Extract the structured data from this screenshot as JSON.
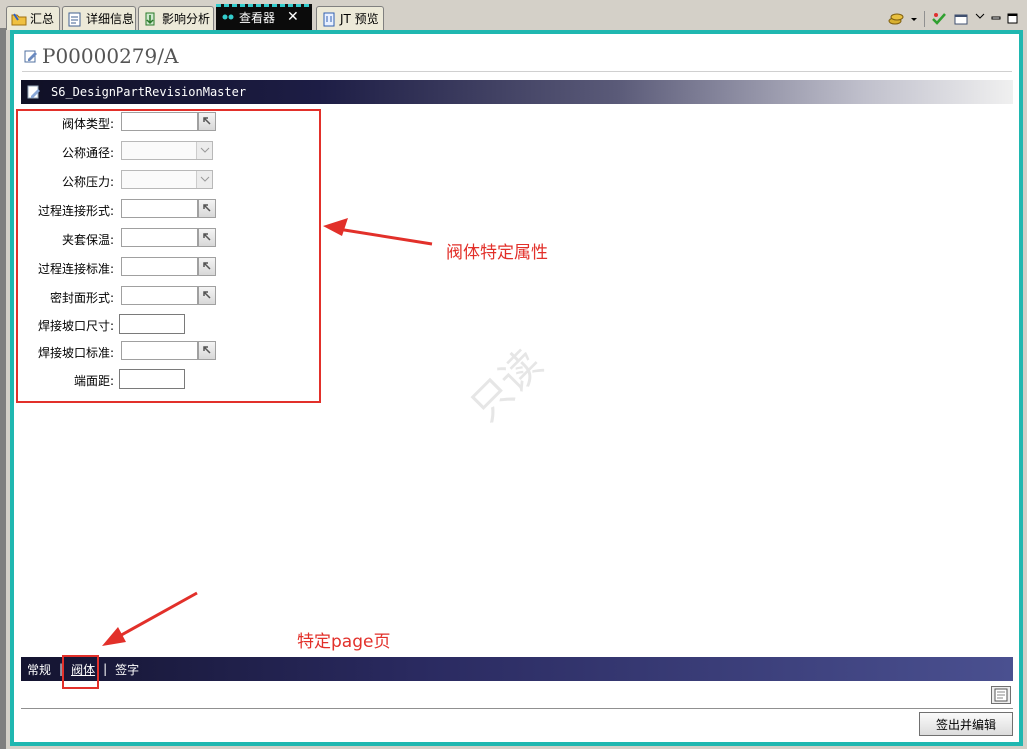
{
  "tabs": [
    {
      "label": "汇总"
    },
    {
      "label": "详细信息"
    },
    {
      "label": "影响分析"
    },
    {
      "label": "查看器",
      "active": true
    },
    {
      "label": "JT 预览"
    }
  ],
  "header": {
    "title": "P00000279/A"
  },
  "type_bar": {
    "label": "S6_DesignPartRevisionMaster"
  },
  "form": {
    "fields": [
      {
        "label": "阀体类型:",
        "control": "lov"
      },
      {
        "label": "公称通径:",
        "control": "combo"
      },
      {
        "label": "公称压力:",
        "control": "combo"
      },
      {
        "label": "过程连接形式:",
        "control": "lov"
      },
      {
        "label": "夹套保温:",
        "control": "lov"
      },
      {
        "label": "过程连接标准:",
        "control": "lov"
      },
      {
        "label": "密封面形式:",
        "control": "lov"
      },
      {
        "label": "焊接坡口尺寸:",
        "control": "text"
      },
      {
        "label": "焊接坡口标准:",
        "control": "lov"
      },
      {
        "label": "端面距:",
        "control": "text"
      }
    ]
  },
  "annotations": {
    "valve_props": "阀体特定属性",
    "page_tab": "特定page页"
  },
  "watermark": "只读",
  "page_tabs": [
    {
      "label": "常规"
    },
    {
      "label": "阀体",
      "selected": true
    },
    {
      "label": "签字"
    }
  ],
  "checkout_button": "签出并编辑",
  "colors": {
    "frame_border": "#1fb7b0",
    "annotation_red": "#e2302a",
    "page_tab_bar": "#2a2a60"
  }
}
